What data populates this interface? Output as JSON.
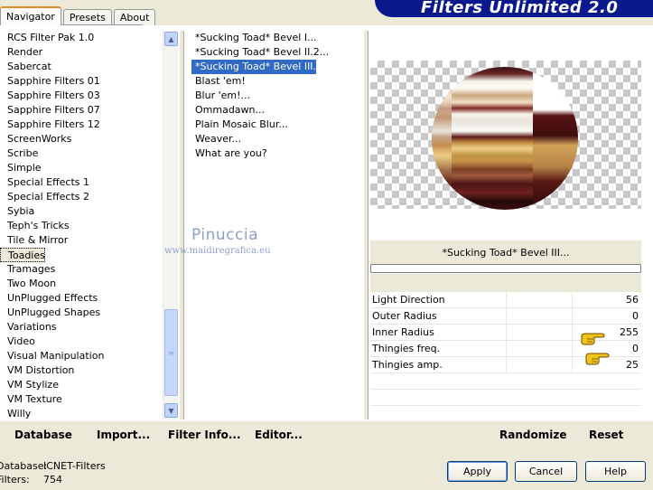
{
  "tabs": [
    "Navigator",
    "Presets",
    "About"
  ],
  "app_title": "Filters Unlimited 2.0",
  "categories": [
    "RCS Filter Pak 1.0",
    "Render",
    "Sabercat",
    "Sapphire Filters 01",
    "Sapphire Filters 03",
    "Sapphire Filters 07",
    "Sapphire Filters 12",
    "ScreenWorks",
    "Scribe",
    "Simple",
    "Special Effects 1",
    "Special Effects 2",
    "Sybia",
    "Teph's Tricks",
    "Tile & Mirror",
    "Toadies",
    "Tramages",
    "Two Moon",
    "UnPlugged Effects",
    "UnPlugged Shapes",
    "Variations",
    "Video",
    "Visual Manipulation",
    "VM Distortion",
    "VM Stylize",
    "VM Texture",
    "Willy"
  ],
  "selected_category": "Toadies",
  "filters": [
    "*Sucking Toad*  Bevel I...",
    "*Sucking Toad*  Bevel II.2...",
    "*Sucking Toad*  Bevel III...",
    "Blast 'em!",
    "Blur 'em!...",
    "Ommadawn...",
    "Plain Mosaic Blur...",
    "Weaver...",
    "What are you?"
  ],
  "selected_filter": "*Sucking Toad*  Bevel III...",
  "watermark": {
    "name": "Pinuccia",
    "url": "www.maidiregrafica.eu"
  },
  "filter_title": "*Sucking Toad*  Bevel III...",
  "params": [
    {
      "name": "Light Direction",
      "value": "56"
    },
    {
      "name": "Outer Radius",
      "value": "0"
    },
    {
      "name": "Inner Radius",
      "value": "255"
    },
    {
      "name": "Thingies freq.",
      "value": "0"
    },
    {
      "name": "Thingies amp.",
      "value": "25"
    }
  ],
  "toolbar": {
    "database": "Database",
    "import": "Import...",
    "filter_info": "Filter Info...",
    "editor": "Editor...",
    "randomize": "Randomize",
    "reset": "Reset"
  },
  "status": {
    "database_label": "Database:",
    "database_value": "ICNET-Filters",
    "filters_label": "Filters:",
    "filters_value": "754"
  },
  "buttons": {
    "apply": "Apply",
    "cancel": "Cancel",
    "help": "Help"
  },
  "icons": {
    "scroll_up": "chevron-up-icon",
    "scroll_down": "chevron-down-icon",
    "hand": "pointing-hand-icon"
  },
  "colors": {
    "banner": "#0a1a8c",
    "selection": "#316ac5",
    "watermark": "#8fa0c7",
    "hand": "#f0c419"
  }
}
